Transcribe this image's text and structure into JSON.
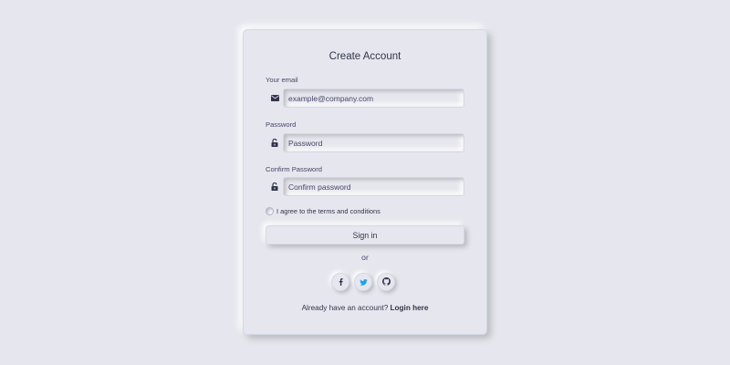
{
  "form": {
    "title": "Create Account",
    "email": {
      "label": "Your email",
      "placeholder": "example@company.com",
      "icon": "envelope-icon"
    },
    "password": {
      "label": "Password",
      "placeholder": "Password",
      "icon": "unlock-icon"
    },
    "confirm_password": {
      "label": "Confirm Password",
      "placeholder": "Confirm password",
      "icon": "unlock-icon"
    },
    "terms_label": "I agree to the terms and conditions",
    "submit_label": "Sign in",
    "divider_text": "or",
    "social": [
      {
        "name": "facebook-icon",
        "color": "#31344b"
      },
      {
        "name": "twitter-icon",
        "color": "#1da1f2"
      },
      {
        "name": "github-icon",
        "color": "#31344b"
      }
    ],
    "footer": {
      "prompt": "Already have an account?",
      "link": "Login here"
    }
  },
  "colors": {
    "background": "#e6e7ee",
    "text": "#31344b",
    "twitter": "#1da1f2"
  }
}
